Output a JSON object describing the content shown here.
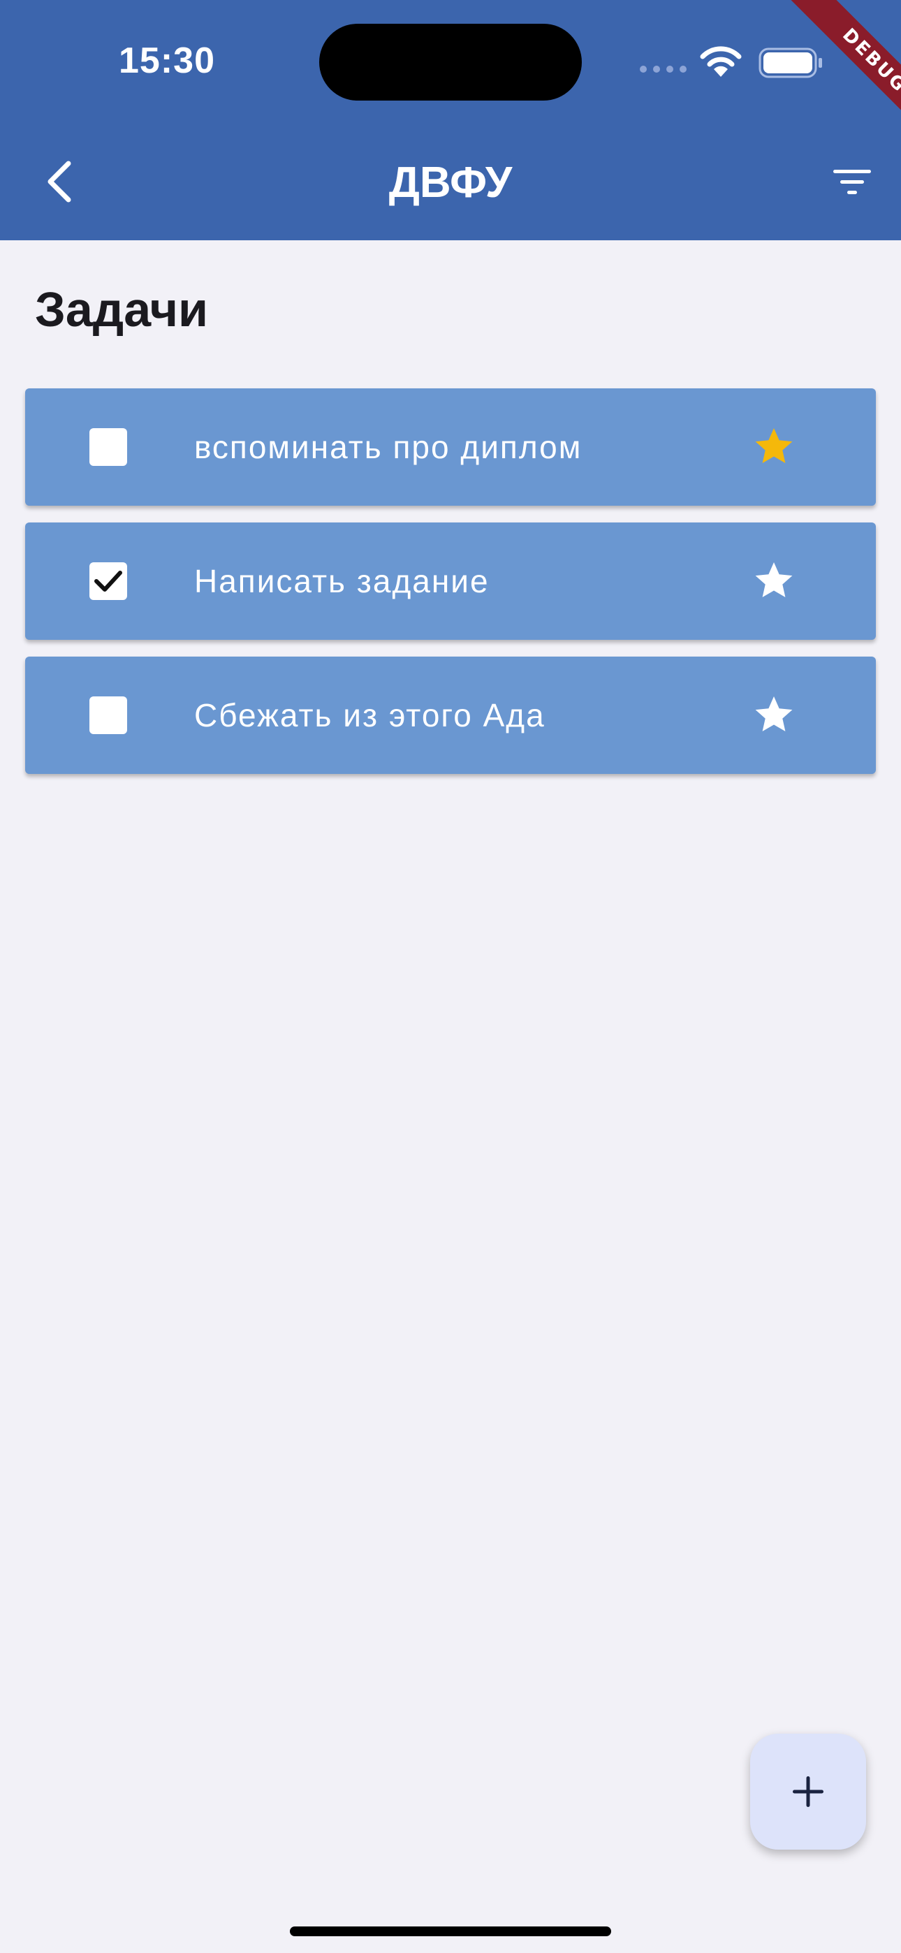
{
  "status_bar": {
    "time": "15:30"
  },
  "debug_banner": "DEBUG",
  "app_bar": {
    "title": "ДВФУ",
    "back_icon": "chevron-left-icon",
    "filter_icon": "filter-icon"
  },
  "section": {
    "title": "Задачи"
  },
  "tasks": [
    {
      "label": "вспоминать про диплом",
      "checked": false,
      "favorite": true
    },
    {
      "label": "Написать задание",
      "checked": true,
      "favorite": false
    },
    {
      "label": "Сбежать из этого Ада",
      "checked": false,
      "favorite": false
    }
  ],
  "fab": {
    "icon": "plus-icon"
  },
  "colors": {
    "app_bar": "#3c65ad",
    "card": "#6a97d1",
    "background": "#f2f1f7",
    "favorite_star": "#f5b80a",
    "default_star": "#ffffff",
    "fab": "#dde3fa",
    "debug_ribbon": "#8a1c2a"
  }
}
